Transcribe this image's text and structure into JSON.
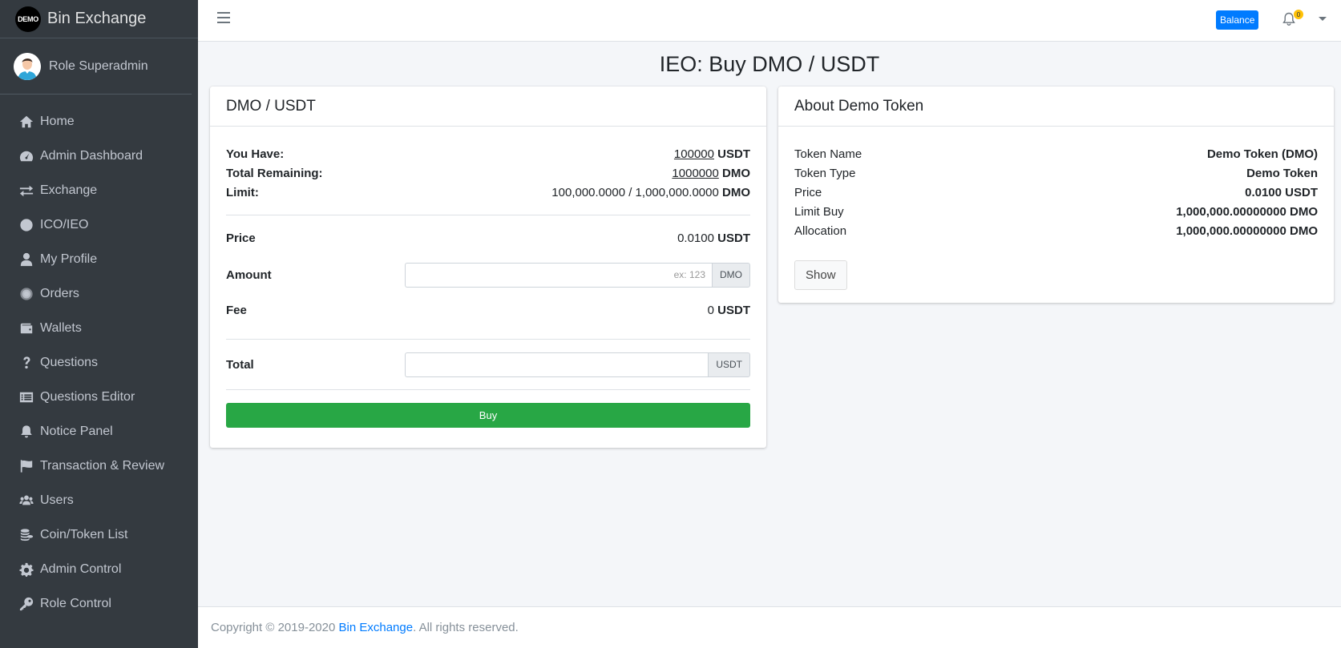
{
  "brand": {
    "logo_text": "DEMO",
    "name": "Bin Exchange"
  },
  "user": {
    "name": "Role Superadmin"
  },
  "sidebar": {
    "items": [
      {
        "label": "Home",
        "icon": "home-icon"
      },
      {
        "label": "Admin Dashboard",
        "icon": "tachometer-icon"
      },
      {
        "label": "Exchange",
        "icon": "exchange-icon"
      },
      {
        "label": "ICO/IEO",
        "icon": "circle-icon"
      },
      {
        "label": "My Profile",
        "icon": "user-icon"
      },
      {
        "label": "Orders",
        "icon": "orders-icon"
      },
      {
        "label": "Wallets",
        "icon": "wallet-icon"
      },
      {
        "label": "Questions",
        "icon": "question-icon"
      },
      {
        "label": "Questions Editor",
        "icon": "list-alt-icon"
      },
      {
        "label": "Notice Panel",
        "icon": "bell-icon"
      },
      {
        "label": "Transaction & Review",
        "icon": "flag-icon"
      },
      {
        "label": "Users",
        "icon": "users-icon"
      },
      {
        "label": "Coin/Token List",
        "icon": "coins-icon"
      },
      {
        "label": "Admin Control",
        "icon": "cog-icon"
      },
      {
        "label": "Role Control",
        "icon": "key-icon"
      }
    ]
  },
  "topbar": {
    "balance_label": "Balance",
    "notification_count": "0"
  },
  "page": {
    "title": "IEO: Buy DMO / USDT"
  },
  "buy_card": {
    "header": "DMO / USDT",
    "you_have_label": "You Have:",
    "you_have_value": "100000",
    "you_have_unit": "USDT",
    "remaining_label": "Total Remaining:",
    "remaining_value": "1000000",
    "remaining_unit": "DMO",
    "limit_label": "Limit:",
    "limit_value": "100,000.0000 / 1,000,000.0000",
    "limit_unit": "DMO",
    "price_label": "Price",
    "price_value": "0.0100",
    "price_unit": "USDT",
    "amount_label": "Amount",
    "amount_placeholder": "ex: 123",
    "amount_unit": "DMO",
    "fee_label": "Fee",
    "fee_value": "0",
    "fee_unit": "USDT",
    "total_label": "Total",
    "total_value": "",
    "total_unit": "USDT",
    "buy_label": "Buy"
  },
  "about_card": {
    "header": "About Demo Token",
    "rows": [
      {
        "label": "Token Name",
        "value": "Demo Token (DMO)"
      },
      {
        "label": "Token Type",
        "value": "Demo Token"
      },
      {
        "label": "Price",
        "value": "0.0100 USDT"
      },
      {
        "label": "Limit Buy",
        "value": "1,000,000.00000000 DMO"
      },
      {
        "label": "Allocation",
        "value": "1,000,000.00000000 DMO"
      }
    ],
    "show_label": "Show"
  },
  "footer": {
    "prefix": "Copyright © 2019-2020 ",
    "link": "Bin Exchange",
    "suffix": ". All rights reserved."
  },
  "colors": {
    "sidebar_bg": "#343a40",
    "primary": "#007bff",
    "success": "#28a745",
    "badge": "#ffc107"
  }
}
